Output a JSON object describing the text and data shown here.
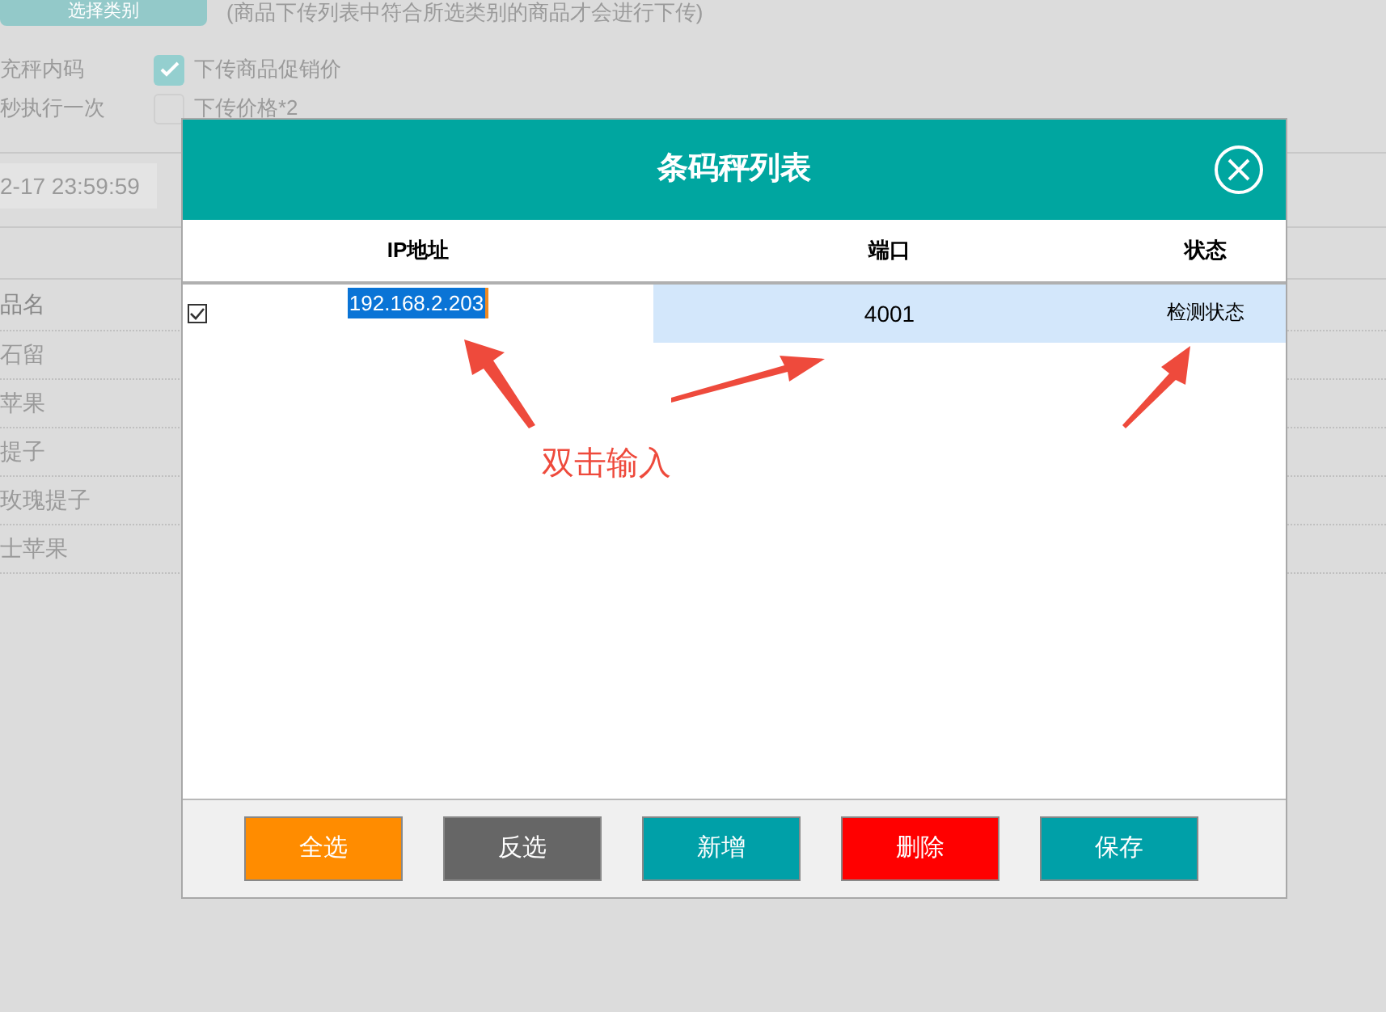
{
  "background": {
    "category_button": "选择类别",
    "category_hint": "(商品下传列表中符合所选类别的商品才会进行下传)",
    "options": [
      {
        "label": "充秤内码",
        "check_label": "下传商品促销价",
        "checked": true
      },
      {
        "label": "秒执行一次",
        "check_label": "下传价格*2",
        "checked": false
      }
    ],
    "date_value": "2-17 23:59:59",
    "table_header": "品名",
    "rows": [
      "石留",
      "苹果",
      "提子",
      "玫瑰提子",
      "士苹果"
    ]
  },
  "dialog": {
    "title": "条码秤列表",
    "columns": [
      "IP地址",
      "端口",
      "状态"
    ],
    "rows": [
      {
        "checked": true,
        "selected": true,
        "ip": "192.168.2.203",
        "port": "4001",
        "status": "检测状态"
      }
    ],
    "buttons": [
      {
        "label": "全选",
        "color": "#ff8c00"
      },
      {
        "label": "反选",
        "color": "#666666"
      },
      {
        "label": "新增",
        "color": "#00a0a8"
      },
      {
        "label": "删除",
        "color": "#ff0000"
      },
      {
        "label": "保存",
        "color": "#00a0a8"
      }
    ]
  },
  "annotation": {
    "text": "双击输入"
  }
}
